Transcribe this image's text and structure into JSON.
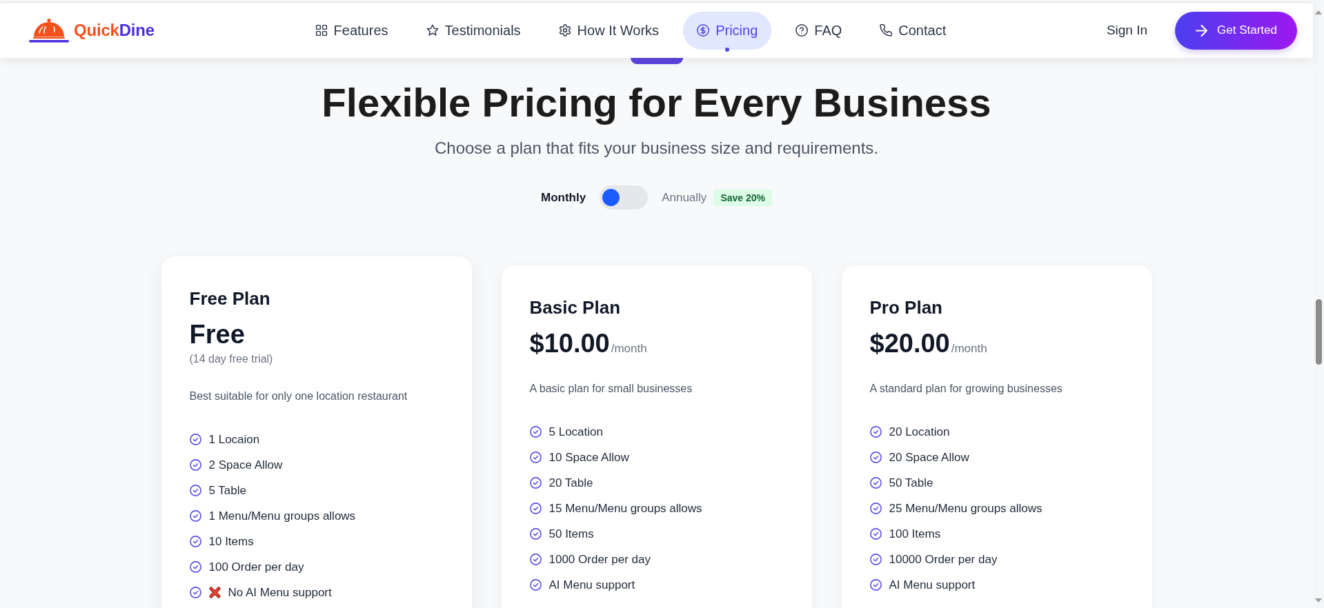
{
  "header": {
    "logo": [
      "Quick",
      "Dine"
    ],
    "nav": [
      {
        "label": "Features",
        "selected": false
      },
      {
        "label": "Testimonials",
        "selected": false
      },
      {
        "label": "How It Works",
        "selected": false
      },
      {
        "label": "Pricing",
        "selected": true
      },
      {
        "label": "FAQ",
        "selected": false
      },
      {
        "label": "Contact",
        "selected": false
      }
    ],
    "sign_in": "Sign In",
    "cta": "Get Started"
  },
  "hero": {
    "title": "Flexible Pricing for Every Business",
    "subtitle": "Choose a plan that fits your business size and requirements."
  },
  "billing": {
    "options": [
      {
        "label": "Monthly",
        "selected": true
      },
      {
        "label": "Annually",
        "selected": false
      }
    ],
    "switch": {
      "on": false
    },
    "discount": "Save 20%"
  },
  "plans": [
    {
      "name": "Free Plan",
      "price": "Free",
      "note": "(14 day free trial)",
      "description": "Best suitable for only one location restaurant",
      "highlighted": true,
      "features": [
        {
          "text": "1 Locaion",
          "kind": "plain"
        },
        {
          "text": "2 Space Allow",
          "kind": "plain"
        },
        {
          "text": "5 Table",
          "kind": "plain"
        },
        {
          "text": "1 Menu/Menu groups allows",
          "kind": "plain"
        },
        {
          "text": "10 Items",
          "kind": "plain"
        },
        {
          "text": "100 Order per day",
          "kind": "plain"
        },
        {
          "text": "No AI Menu support",
          "kind": "crossed"
        }
      ]
    },
    {
      "name": "Basic Plan",
      "price": "$10.00",
      "period": "/month",
      "description": "A basic plan for small businesses",
      "highlighted": false,
      "features": [
        {
          "text": "5 Location",
          "kind": "plain"
        },
        {
          "text": "10 Space Allow",
          "kind": "plain"
        },
        {
          "text": "20 Table",
          "kind": "plain"
        },
        {
          "text": "15 Menu/Menu groups allows",
          "kind": "plain"
        },
        {
          "text": "50 Items",
          "kind": "plain"
        },
        {
          "text": "1000 Order per day",
          "kind": "plain"
        },
        {
          "text": "AI Menu support",
          "kind": "plain"
        }
      ]
    },
    {
      "name": "Pro Plan",
      "price": "$20.00",
      "period": "/month",
      "description": "A standard plan for growing businesses",
      "highlighted": false,
      "features": [
        {
          "text": "20 Location",
          "kind": "plain"
        },
        {
          "text": "20 Space Allow",
          "kind": "plain"
        },
        {
          "text": "50 Table",
          "kind": "plain"
        },
        {
          "text": "25 Menu/Menu groups allows",
          "kind": "plain"
        },
        {
          "text": "100 Items",
          "kind": "plain"
        },
        {
          "text": "10000 Order per day",
          "kind": "plain"
        },
        {
          "text": "AI Menu support",
          "kind": "plain"
        }
      ]
    }
  ]
}
